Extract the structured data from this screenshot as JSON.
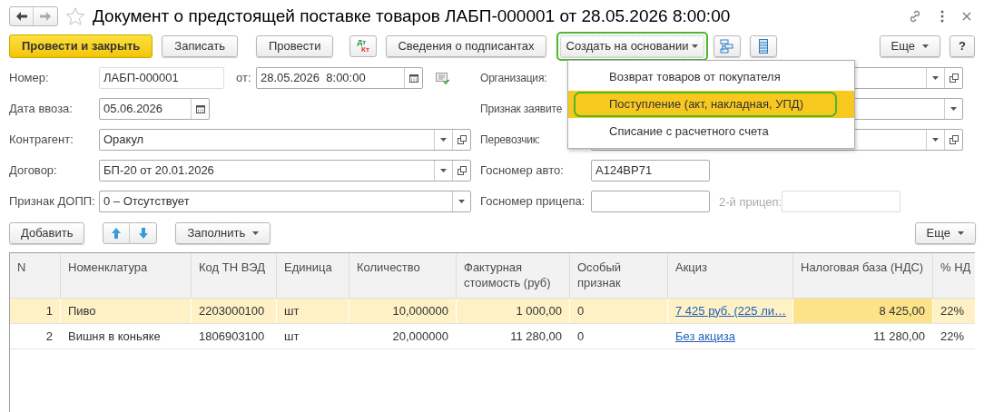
{
  "window": {
    "title": "Документ о предстоящей поставке товаров ЛАБП-000001 от 28.05.2026 8:00:00"
  },
  "toolbar": {
    "primary": "Провести и закрыть",
    "buttons": [
      "Записать",
      "Провести"
    ],
    "dtkt": {
      "dt": "Дт",
      "kt": "Кт"
    },
    "signers": "Сведения о подписантах",
    "create_based": {
      "label": "Создать на основании",
      "outlined": true
    },
    "more": "Еще",
    "help": "?"
  },
  "menu": {
    "items": [
      {
        "label": "Возврат товаров от покупателя",
        "selected": false,
        "outlined": false
      },
      {
        "label": "Поступление (акт, накладная, УПД)",
        "selected": true,
        "outlined": true
      },
      {
        "label": "Списание с расчетного счета",
        "selected": false,
        "outlined": false
      }
    ]
  },
  "form": {
    "number": {
      "label": "Номер:",
      "value": "ЛАБП-000001"
    },
    "date": {
      "label": "от:",
      "value": "28.05.2026  8:00:00"
    },
    "import_date": {
      "label": "Дата ввоза:",
      "value": "05.06.2026"
    },
    "left": [
      {
        "label": "Контрагент:",
        "value": "Оракул",
        "open": true
      },
      {
        "label": "Договор:",
        "value": "БП-20 от 20.01.2026",
        "open": true
      },
      {
        "label": "Признак ДОПП:",
        "value": "0 – Отсутствует",
        "open": false
      }
    ],
    "right": [
      {
        "label": "Организация:",
        "open": true
      },
      {
        "label": "Признак заявите",
        "open": false
      },
      {
        "label": "Перевозчик:",
        "open": true
      }
    ],
    "plate": {
      "label": "Госномер авто:",
      "value": "А124ВР71"
    },
    "trailer": {
      "label": "Госномер прицепа:"
    },
    "trailer2": {
      "label": "2-й прицеп:",
      "disabled": true
    }
  },
  "table_toolbar": {
    "add": "Добавить",
    "fill": "Заполнить",
    "more": "Еще"
  },
  "table": {
    "columns": [
      {
        "label": "N",
        "kind": "number"
      },
      {
        "label": "Номенклатура",
        "kind": "text"
      },
      {
        "label": "Код ТН ВЭД",
        "kind": "text"
      },
      {
        "label": "Единица",
        "kind": "text"
      },
      {
        "label": "Количество",
        "kind": "number"
      },
      {
        "label": "Фактурная стоимость (руб)",
        "kind": "number"
      },
      {
        "label": "Особый признак",
        "kind": "text"
      },
      {
        "label": "Акциз",
        "kind": "link"
      },
      {
        "label": "Налоговая база (НДС)",
        "kind": "number"
      },
      {
        "label": "% НД",
        "kind": "text"
      }
    ],
    "rows": [
      {
        "selected": true,
        "cells": [
          {
            "text": "1",
            "focused": false
          },
          {
            "text": "Пиво",
            "focused": false
          },
          {
            "text": "2203000100",
            "focused": false
          },
          {
            "text": "шт",
            "focused": false
          },
          {
            "text": "10,000000",
            "focused": false
          },
          {
            "text": "1 000,00",
            "focused": false
          },
          {
            "text": "0",
            "focused": false
          },
          {
            "text": "7 425 руб. (225 ли…",
            "focused": false
          },
          {
            "text": "8 425,00",
            "focused": true
          },
          {
            "text": "22%",
            "focused": false
          }
        ]
      },
      {
        "selected": false,
        "cells": [
          {
            "text": "2",
            "focused": false
          },
          {
            "text": "Вишня в коньяке",
            "focused": false
          },
          {
            "text": "1806903100",
            "focused": false
          },
          {
            "text": "шт",
            "focused": false
          },
          {
            "text": "20,000000",
            "focused": false
          },
          {
            "text": "11 280,00",
            "focused": false
          },
          {
            "text": "0",
            "focused": false
          },
          {
            "text": "Без акциза",
            "focused": false
          },
          {
            "text": "11 280,00",
            "focused": false
          },
          {
            "text": "22%",
            "focused": false
          }
        ]
      }
    ]
  }
}
